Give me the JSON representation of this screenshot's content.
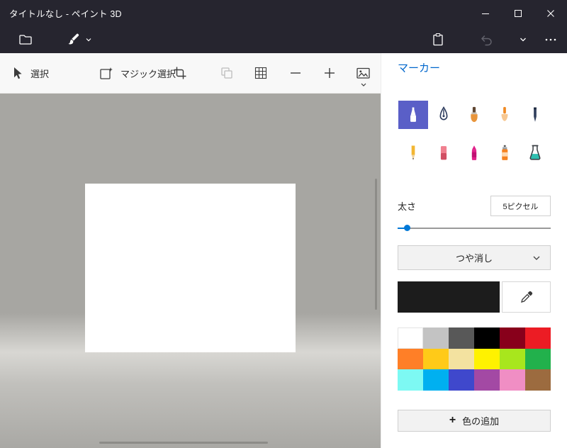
{
  "window": {
    "title": "タイトルなし - ペイント 3D"
  },
  "menubar": {
    "icons": [
      "folder",
      "brush-menu",
      "brush-menu-chevron",
      "paste",
      "undo",
      "history-chevron",
      "more-ellipsis"
    ]
  },
  "toolbar": {
    "select_label": "選択",
    "magic_select_label": "マジック選択",
    "icons": [
      "select-arrow",
      "magic-select",
      "crop",
      "copy",
      "grid",
      "zoom-out",
      "zoom-in",
      "insert-image",
      "insert-image-chevron"
    ]
  },
  "sidebar": {
    "title": "マーカー",
    "tools": [
      "marker",
      "calligraphy-pen",
      "oil-brush",
      "watercolor",
      "pixel-pen",
      "pencil",
      "eraser",
      "crayon",
      "spray-can",
      "fill"
    ],
    "selected_tool": "marker",
    "thickness_label": "太さ",
    "thickness_value": "5ピクセル",
    "finish_selected": "つや消し",
    "current_color": "#1c1c1c",
    "palette": [
      "#ffffff",
      "#c3c3c3",
      "#585858",
      "#000000",
      "#88001b",
      "#ec1c24",
      "#ff7f27",
      "#ffca18",
      "#f3e2a0",
      "#fff200",
      "#a8e61d",
      "#22b14c",
      "#7df9f3",
      "#00b0f0",
      "#3f48cc",
      "#a349a4",
      "#f08ec4",
      "#9c6b3f"
    ],
    "add_color_plus": "+",
    "add_color_label": "色の追加"
  },
  "colors": {
    "titlebar_bg": "#26252f",
    "accent_blue": "#0066cc",
    "selected_tool_bg": "#5a5fc7",
    "slider_blue": "#0078d7"
  }
}
